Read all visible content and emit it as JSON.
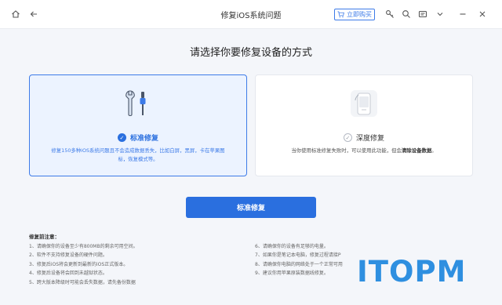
{
  "titlebar": {
    "title": "修复iOS系统问题",
    "buy_label": "立即购买",
    "icons": [
      "home-icon",
      "back-arrow-icon",
      "cart-icon",
      "key-icon",
      "search-icon",
      "message-icon",
      "chevron-down-icon",
      "minimize-icon",
      "close-icon"
    ]
  },
  "heading": "请选择你要修复设备的方式",
  "modes": {
    "standard": {
      "title": "标准修复",
      "selected": true,
      "description": "修复150多种iOS系统问题且不会造成数据丢失，比如白屏，黑屏，卡在苹果图标，恢复模式等。"
    },
    "deep": {
      "title": "深度修复",
      "selected": false,
      "description_pre": "当你使用标准修复失败时，可以使用此功能，但会",
      "description_bold": "清除设备数据",
      "description_post": "。"
    }
  },
  "primary_button": "标准修复",
  "notes": {
    "title": "修复前注意：",
    "left": [
      "1、请确保你的设备至少有800MB的剩余可用空间。",
      "2、软件不支持修复设备的硬件问题。",
      "3、修复后iOS将会更新到最新的iOS正式版本。",
      "4、修复后设备将会回到未越狱状态。",
      "5、跨大版本降级时可能会丢失数据，请先备份数据"
    ],
    "right": [
      "6、请确保你的设备有足够的电量。",
      "7、如果你是笔记本电脑，修复过程请接P",
      "8、请确保你电脑的网络处于一个正常可用",
      "9、建议你用苹果原装数据线修复。"
    ]
  },
  "watermark": "ITOPM",
  "colors": {
    "accent": "#2a6fdf",
    "selected_card_bg": "#ecf3ff",
    "watermark": "#2e8fe0"
  }
}
